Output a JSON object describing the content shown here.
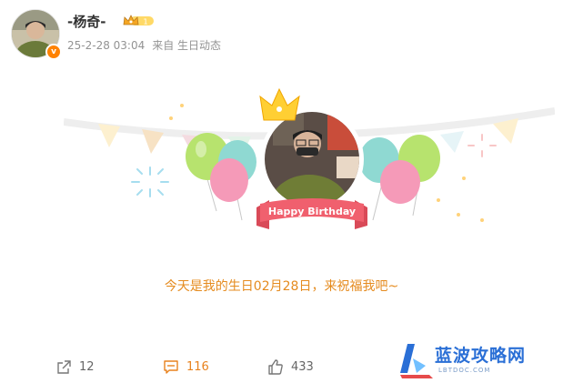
{
  "post": {
    "author": "-杨奇-",
    "date": "25-2-28 03:04",
    "source": "来自 生日动态",
    "caption": "今天是我的生日02月28日，来祝福我吧~"
  },
  "birthday_card": {
    "banner_text": "Happy Birthday"
  },
  "actions": {
    "share_count": "12",
    "comment_count": "116",
    "like_count": "433"
  },
  "watermark": {
    "title": "蓝波攻略网",
    "subtitle": "LBTDOC.COM"
  },
  "icons": [
    "verified-v-icon",
    "crown-level-icon",
    "share-icon",
    "comment-icon",
    "like-icon",
    "watermark-logo-icon"
  ],
  "colors": {
    "accent": "#ff8200",
    "caption": "#e58b1f",
    "meta": "#939393",
    "banner": "#f0606e"
  }
}
